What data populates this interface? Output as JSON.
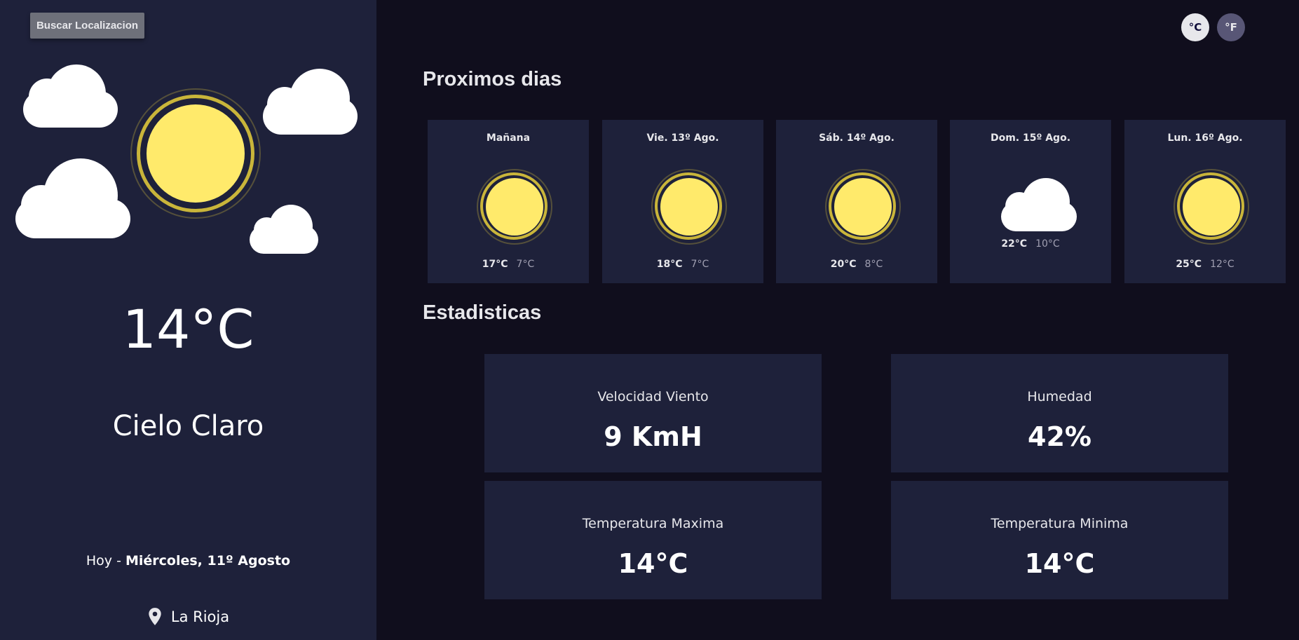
{
  "sidebar": {
    "search_label": "Buscar Localizacion",
    "current_temp": "14°C",
    "condition": "Cielo Claro",
    "date_prefix": "Hoy - ",
    "date_value": "Miércoles, 11º Agosto",
    "location": "La Rioja"
  },
  "units": {
    "celsius": "°C",
    "fahrenheit": "°F",
    "active": "celsius"
  },
  "forecast": {
    "title": "Proximos dias",
    "days": [
      {
        "name": "Mañana",
        "icon": "sun-icon",
        "max": "17°C",
        "min": "7°C"
      },
      {
        "name": "Vie. 13º Ago.",
        "icon": "sun-icon",
        "max": "18°C",
        "min": "7°C"
      },
      {
        "name": "Sáb. 14º Ago.",
        "icon": "sun-icon",
        "max": "20°C",
        "min": "8°C"
      },
      {
        "name": "Dom. 15º Ago.",
        "icon": "cloud-icon",
        "max": "22°C",
        "min": "10°C"
      },
      {
        "name": "Lun. 16º Ago.",
        "icon": "sun-icon",
        "max": "25°C",
        "min": "12°C"
      }
    ]
  },
  "stats": {
    "title": "Estadisticas",
    "items": [
      {
        "label": "Velocidad Viento",
        "value": "9 KmH"
      },
      {
        "label": "Humedad",
        "value": "42%"
      },
      {
        "label": "Temperatura Maxima",
        "value": "14°C"
      },
      {
        "label": "Temperatura Minima",
        "value": "14°C"
      }
    ]
  },
  "colors": {
    "background": "#100e1d",
    "panel": "#1e213a",
    "sun": "#ffea6b",
    "text": "#e7e7eb"
  }
}
